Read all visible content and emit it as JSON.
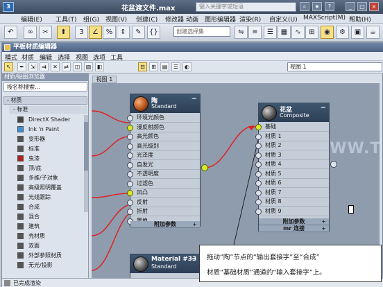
{
  "app": {
    "title": "花盆渡文件.max",
    "search_placeholder": "键入关键字或短语",
    "menu": [
      "编辑(E)",
      "工具(T)",
      "组(G)",
      "视图(V)",
      "创建(C)",
      "修改器",
      "动画",
      "图形编辑器",
      "渲染(R)",
      "自定义(U)",
      "MAXScript(M)",
      "帮助(H)"
    ],
    "selection_set_placeholder": "创建选择集"
  },
  "editor": {
    "title": "平板材质编辑器",
    "menu": [
      "模式",
      "材质",
      "编辑",
      "选择",
      "视图",
      "选项",
      "工具"
    ],
    "view_dropdown": "视图 1",
    "view_tab": "视图 1"
  },
  "browser": {
    "header": "材质/贴图浏览器",
    "search": "按名称搜索...",
    "group": "- 材质",
    "subgroup": "- 标准",
    "items": [
      {
        "label": "DirectX Shader",
        "color": "#444444"
      },
      {
        "label": "Ink 'n Paint",
        "color": "#3a8fd6"
      },
      {
        "label": "变形器",
        "color": "#555555"
      },
      {
        "label": "标准",
        "color": "#555555"
      },
      {
        "label": "虫漆",
        "color": "#b02020"
      },
      {
        "label": "顶/底",
        "color": "#555555"
      },
      {
        "label": "多维/子对象",
        "color": "#555555"
      },
      {
        "label": "高级照明覆盖",
        "color": "#555555"
      },
      {
        "label": "光线跟踪",
        "color": "#555555"
      },
      {
        "label": "合成",
        "color": "#555555"
      },
      {
        "label": "混合",
        "color": "#555555"
      },
      {
        "label": "建筑",
        "color": "#555555"
      },
      {
        "label": "壳材质",
        "color": "#555555"
      },
      {
        "label": "双面",
        "color": "#555555"
      },
      {
        "label": "外部参照材质",
        "color": "#555555"
      },
      {
        "label": "无光/投影",
        "color": "#555555"
      }
    ]
  },
  "status": {
    "text": "已完成渲染"
  },
  "nodes": {
    "tao": {
      "name": "陶",
      "type": "Standard",
      "slots": [
        "环境光颜色",
        "漫反射颜色",
        "高光颜色",
        "高光级别",
        "光泽度",
        "自发光",
        "不透明度",
        "过滤色",
        "凹凸",
        "反射",
        "折射",
        "置换"
      ],
      "active_slots": [
        1,
        8
      ],
      "rollups": [
        "附加参数",
        "mr 连接"
      ],
      "collapse": "−"
    },
    "huapen": {
      "name": "花盆",
      "type": "Composite",
      "slots": [
        "基础",
        "材质 1",
        "材质 2",
        "材质 3",
        "材质 4",
        "材质 5",
        "材质 6",
        "材质 7",
        "材质 8",
        "材质 9"
      ],
      "active_slots": [
        0
      ],
      "rollups": [
        "附加参数",
        "mr 连接"
      ],
      "collapse": "−"
    },
    "mat33": {
      "name": "Material #33",
      "type": "Standard",
      "collapse": "−"
    }
  },
  "callout": {
    "line1": "拖动“陶”节点的“输出套接字”至“合成”",
    "line2": "材质“基础材质”通道的“输入套接字”上。"
  },
  "watermark": "WWW.TLYI.NET",
  "colors": {
    "socket_active": "#d8ea2a",
    "wire": "#e02020"
  }
}
